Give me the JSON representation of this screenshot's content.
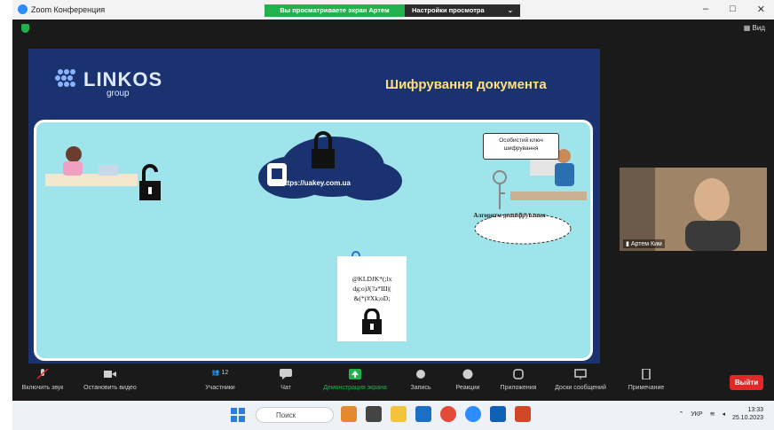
{
  "window": {
    "title": "Zoom Конференция",
    "share_banner": "Вы просматриваете экран Артем Ким",
    "view_options": "Настройки просмотра",
    "controls": [
      "–",
      "□",
      "✕"
    ]
  },
  "meeting": {
    "view_label": "Вид"
  },
  "slide": {
    "logo_text": "LINKOS",
    "logo_sub": "group",
    "title": "Шифрування документа",
    "url": "https://uakey.com.ua",
    "private_key_bubble": "Особистий ключ шифрування",
    "algorithm_cloud": "Алгоритм дешифрування",
    "encrypted_text": [
      "@KLDJK*(;lx",
      "dg;o)J(?a*Ш|(",
      "&(*(#Хk;oD;"
    ]
  },
  "video": {
    "participant_name": "Артем Ким"
  },
  "toolbar": {
    "unmute": "Включить звук",
    "stop_video": "Остановить видео",
    "participants": "Участники",
    "participants_count": "12",
    "chat": "Чат",
    "share": "Демонстрация экрана",
    "record": "Запись",
    "reactions": "Реакции",
    "apps": "Приложения",
    "whiteboards": "Доски сообщений",
    "notes": "Примечание",
    "leave": "Выйти"
  },
  "taskbar": {
    "search_placeholder": "Поиск",
    "language": "УКР",
    "time": "13:33",
    "date": "25.10.2023"
  },
  "colors": {
    "share_green": "#23b14d",
    "leave_red": "#e02828",
    "slide_bg": "#1b3270",
    "panel_bg": "#9fe4ea",
    "title_yellow": "#ffe07a"
  }
}
